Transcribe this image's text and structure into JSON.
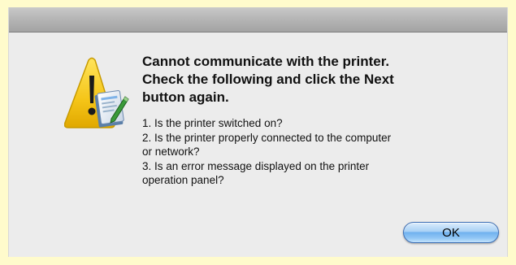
{
  "dialog": {
    "headline": [
      "Cannot communicate with the printer.",
      "Check the following and click the Next",
      "button again."
    ],
    "details": [
      "1. Is the printer switched on?",
      "2. Is the printer properly connected to the computer",
      "or network?",
      "3. Is an error message displayed on the printer",
      "operation panel?"
    ],
    "ok_label": "OK",
    "icon": "warning-triangle-with-printer-utility-icon"
  },
  "colors": {
    "background": "#fffbcc",
    "dialog": "#ececec",
    "warning_yellow": "#f5c518",
    "button_blue": "#6fb1ee"
  }
}
